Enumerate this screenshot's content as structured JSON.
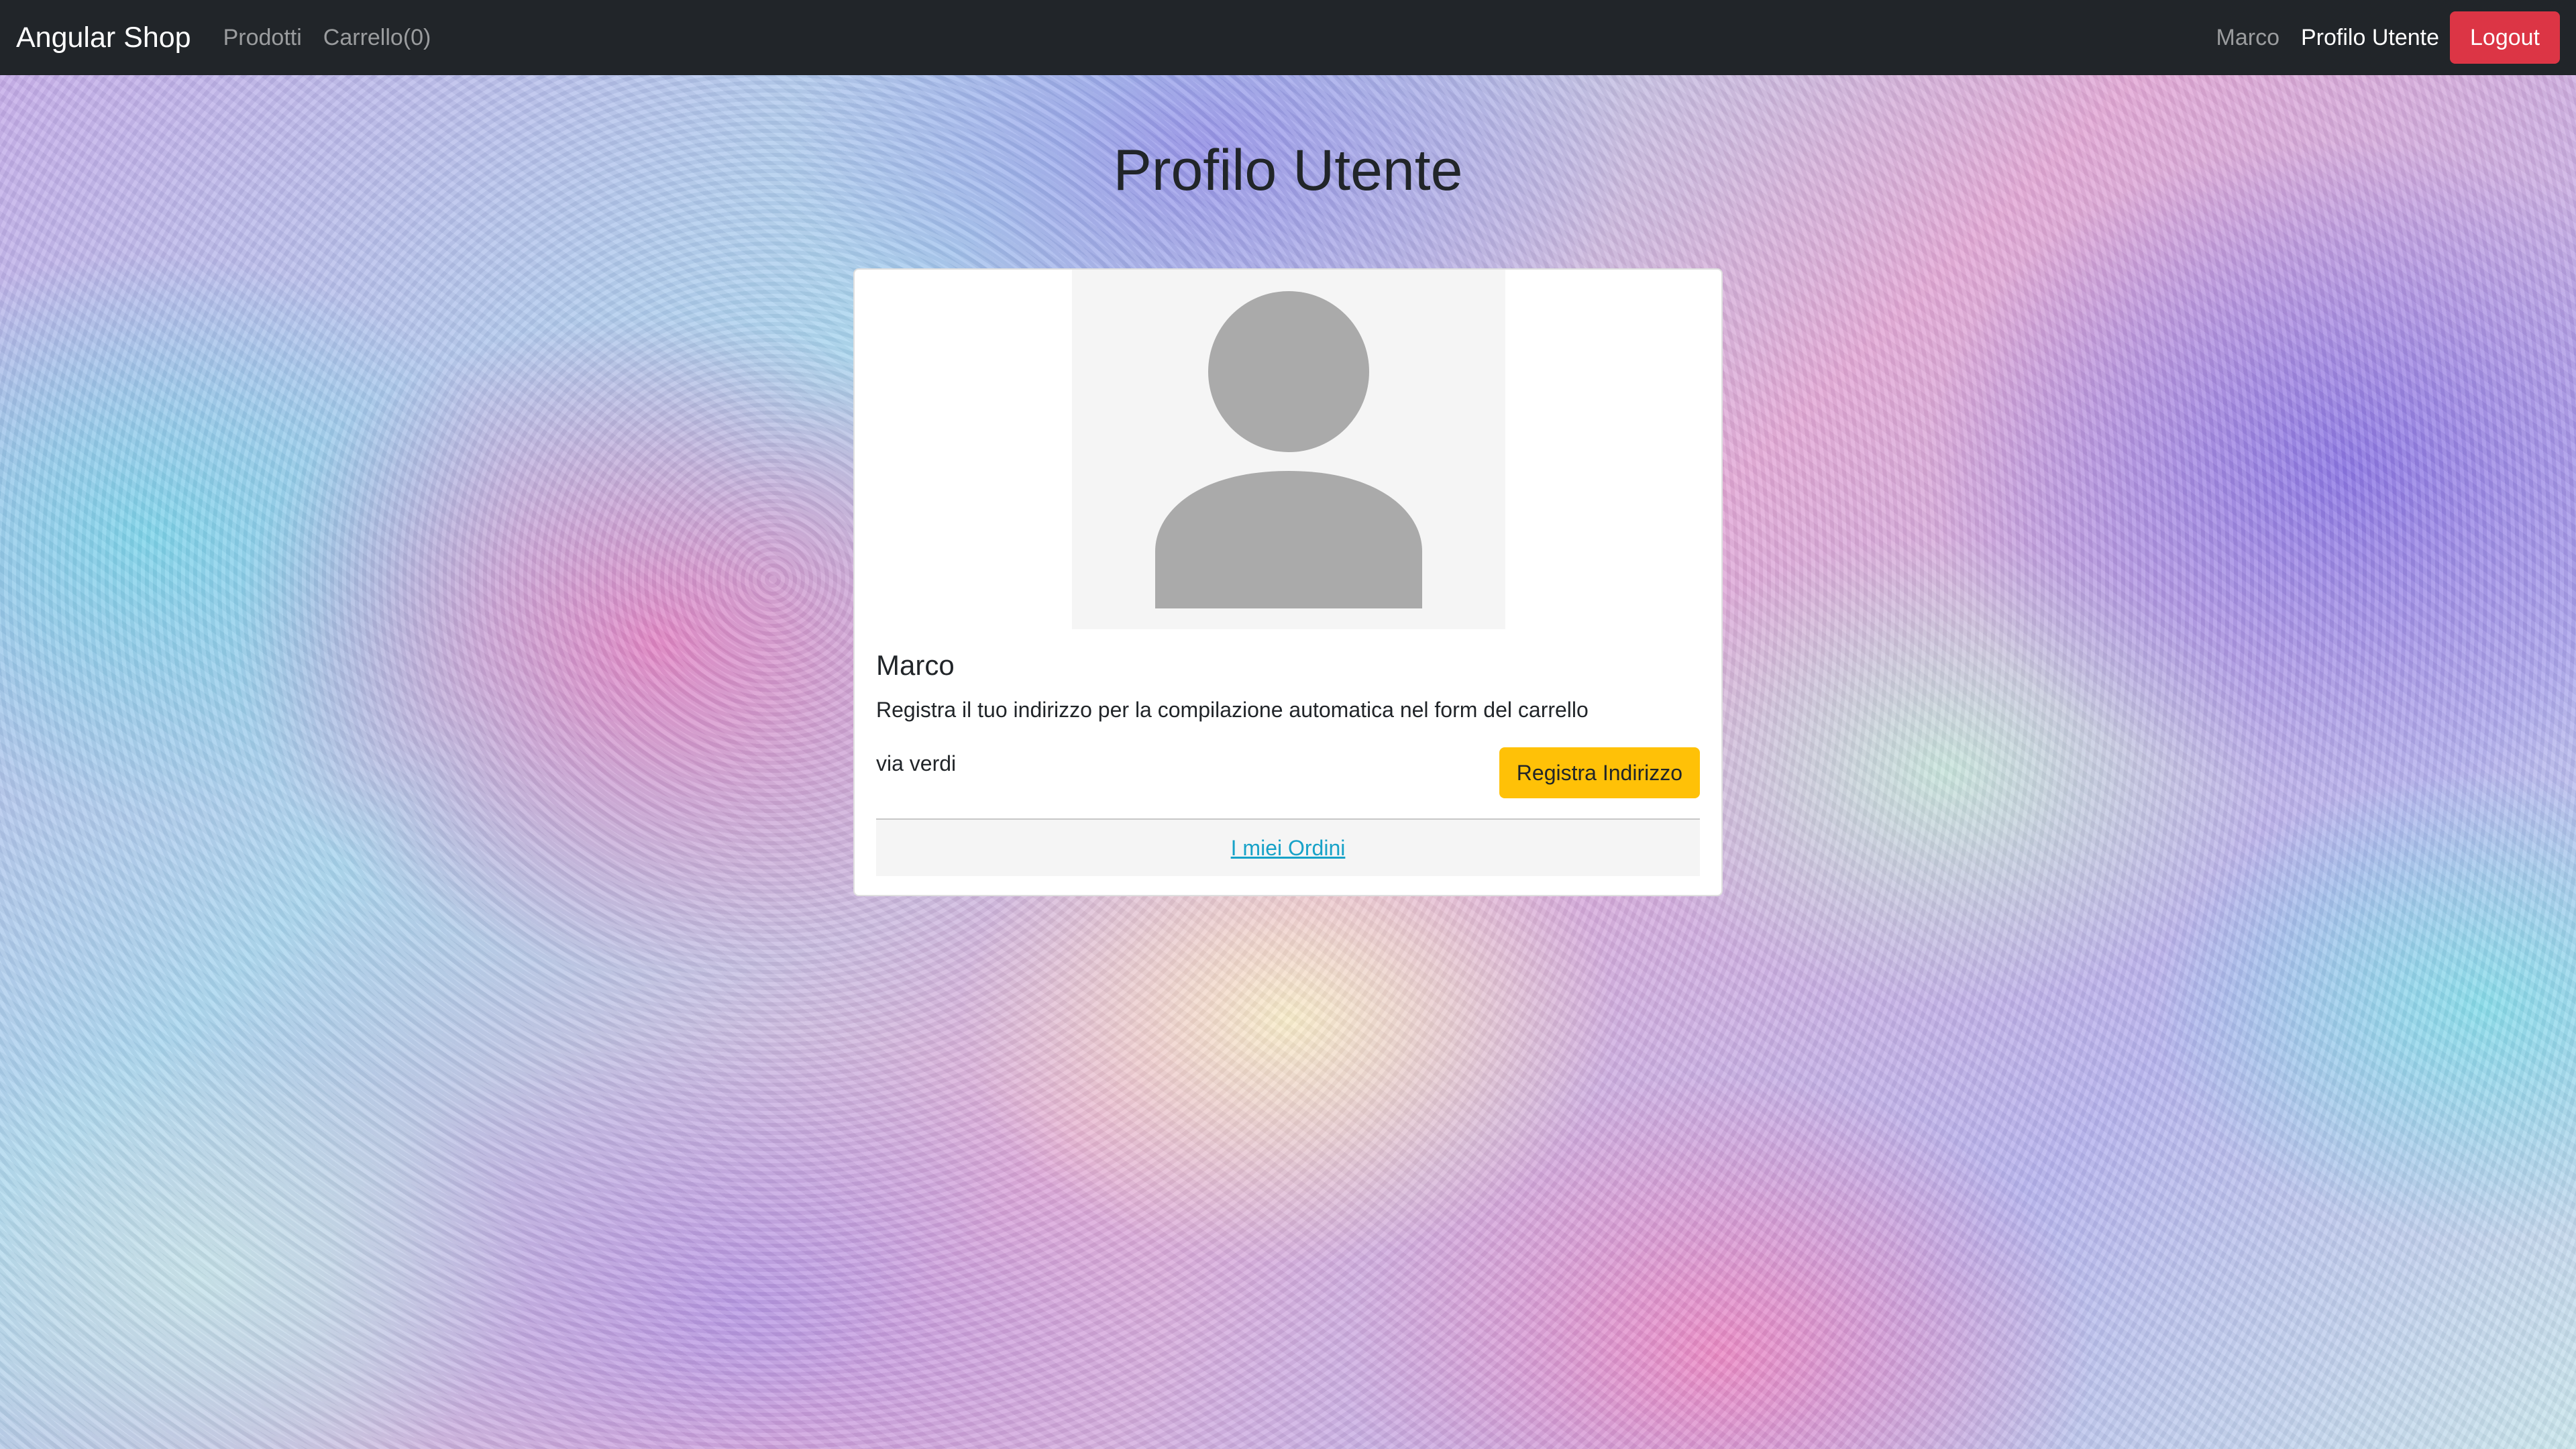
{
  "navbar": {
    "brand": "Angular Shop",
    "links": {
      "products": "Prodotti",
      "cart": "Carrello(0)"
    },
    "user_name": "Marco",
    "profile_link": "Profilo Utente",
    "logout_label": "Logout"
  },
  "page": {
    "title": "Profilo Utente"
  },
  "profile_card": {
    "avatar_icon": "user-placeholder-icon",
    "name": "Marco",
    "description": "Registra il tuo indirizzo per la compilazione automatica nel form del carrello",
    "address": "via verdi",
    "register_address_label": "Registra Indirizzo",
    "orders_link": "I miei Ordini"
  },
  "colors": {
    "navbar_bg": "#212529",
    "logout_bg": "#dc3545",
    "register_button_bg": "#ffc107",
    "orders_link": "#17a2c8"
  }
}
